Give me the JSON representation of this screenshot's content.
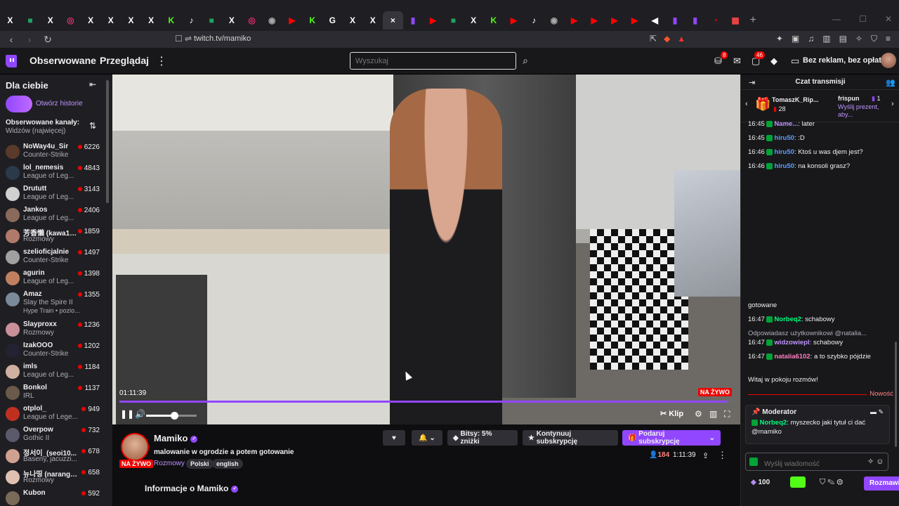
{
  "browser": {
    "tabs": [
      {
        "glyph": "X",
        "color": "#ffffff"
      },
      {
        "glyph": "■",
        "color": "#1fa463"
      },
      {
        "glyph": "X",
        "color": "#ffffff"
      },
      {
        "glyph": "◎",
        "color": "#e1306c"
      },
      {
        "glyph": "X",
        "color": "#ffffff"
      },
      {
        "glyph": "X",
        "color": "#ffffff"
      },
      {
        "glyph": "X",
        "color": "#ffffff"
      },
      {
        "glyph": "X",
        "color": "#ffffff"
      },
      {
        "glyph": "K",
        "color": "#53fc18"
      },
      {
        "glyph": "♪",
        "color": "#ffffff"
      },
      {
        "glyph": "■",
        "color": "#1fa463"
      },
      {
        "glyph": "X",
        "color": "#ffffff"
      },
      {
        "glyph": "◎",
        "color": "#e1306c"
      },
      {
        "glyph": "◉",
        "color": "#aaaaaa"
      },
      {
        "glyph": "▶",
        "color": "#ff0000"
      },
      {
        "glyph": "K",
        "color": "#53fc18"
      },
      {
        "glyph": "G",
        "color": "#ffffff"
      },
      {
        "glyph": "X",
        "color": "#ffffff"
      },
      {
        "glyph": "X",
        "color": "#ffffff"
      },
      {
        "glyph": "×",
        "color": "#ffffff"
      },
      {
        "glyph": "▮",
        "color": "#9147ff"
      },
      {
        "glyph": "▶",
        "color": "#ff0000"
      },
      {
        "glyph": "■",
        "color": "#1fa463"
      },
      {
        "glyph": "X",
        "color": "#ffffff"
      },
      {
        "glyph": "K",
        "color": "#53fc18"
      },
      {
        "glyph": "▶",
        "color": "#ff0000"
      },
      {
        "glyph": "♪",
        "color": "#ffffff"
      },
      {
        "glyph": "◉",
        "color": "#aaaaaa"
      },
      {
        "glyph": "▶",
        "color": "#ff0000"
      },
      {
        "glyph": "▶",
        "color": "#ff0000"
      },
      {
        "glyph": "▶",
        "color": "#ff0000"
      },
      {
        "glyph": "▶",
        "color": "#ff0000"
      },
      {
        "glyph": "◀",
        "color": "#ffffff"
      },
      {
        "glyph": "▮",
        "color": "#9147ff"
      },
      {
        "glyph": "▮",
        "color": "#9147ff"
      },
      {
        "glyph": "◔",
        "color": "#ff0000"
      },
      {
        "glyph": "▦",
        "color": "#ff4444"
      }
    ],
    "active_tab_index": 19,
    "url": "twitch.tv/mamiko"
  },
  "topnav": {
    "following": "Obserwowane",
    "browse": "Przeglądaj",
    "search_placeholder": "Wyszukaj",
    "inbox_badge": "8",
    "notif_badge": "46",
    "ad_free": "Bez reklam, bez opłat",
    "brand_color": "#9147ff"
  },
  "sidebar": {
    "title": "Dla ciebie",
    "stories_link": "Otwórz historie",
    "followed_title": "Obserwowane kanały:",
    "sort": "Widzów (najwięcej)",
    "channels": [
      {
        "name": "NoWay4u_Sir",
        "game": "Counter-Strike",
        "viewers": "6226",
        "avatar": "#5a3a2a"
      },
      {
        "name": "lol_nemesis",
        "game": "League of Leg...",
        "viewers": "4843",
        "avatar": "#2a3a4a"
      },
      {
        "name": "Drututt",
        "game": "League of Leg...",
        "viewers": "3143",
        "avatar": "#d0d0d0"
      },
      {
        "name": "Jankos",
        "game": "League of Leg...",
        "viewers": "2406",
        "avatar": "#8a6a5a"
      },
      {
        "name": "芳香懶 (kawa1s...",
        "game": "Rozmowy",
        "viewers": "1859",
        "avatar": "#b07a6a"
      },
      {
        "name": "szelioficjalnie",
        "game": "Counter-Strike",
        "viewers": "1497",
        "avatar": "#a0a0a0"
      },
      {
        "name": "agurin",
        "game": "League of Leg...",
        "viewers": "1398",
        "avatar": "#c08060"
      },
      {
        "name": "Amaz",
        "game": "Slay the Spire II",
        "viewers": "1355",
        "avatar": "#7a8a9a",
        "extra": "Hype Train • pozio..."
      },
      {
        "name": "Slayproxx",
        "game": "Rozmowy",
        "viewers": "1236",
        "avatar": "#c9909a"
      },
      {
        "name": "IzakOOO",
        "game": "Counter-Strike",
        "viewers": "1202",
        "avatar": "#222233"
      },
      {
        "name": "imls",
        "game": "League of Leg...",
        "viewers": "1184",
        "avatar": "#d0b0a0"
      },
      {
        "name": "Bonkol",
        "game": "IRL",
        "viewers": "1137",
        "avatar": "#6a5a4a"
      },
      {
        "name": "otplol_",
        "game": "League of Lege...",
        "viewers": "949",
        "avatar": "#c03020"
      },
      {
        "name": "Overpow",
        "game": "Gothic II",
        "viewers": "732",
        "avatar": "#5a5a6a"
      },
      {
        "name": "정서이_(seoi10...",
        "game": "Baseny, jacuzzi...",
        "viewers": "678",
        "avatar": "#d0a090"
      },
      {
        "name": "뉴나띵 (narang_...",
        "game": "Rozmowy",
        "viewers": "658",
        "avatar": "#e0c0b0"
      },
      {
        "name": "Kubon",
        "game": "",
        "viewers": "592",
        "avatar": "#7a6a5a"
      }
    ]
  },
  "player": {
    "elapsed": "01:11:39",
    "live": "NA ŻYWO",
    "progress": 0.99,
    "volume": 0.55,
    "clip": "Klip"
  },
  "stream": {
    "name": "Mamiko",
    "title": "malowanie w ogrodzie a potem gotowanie",
    "category": "Rozmowy",
    "tags": [
      "Polski",
      "english"
    ],
    "live": "NA ŻYWO",
    "bits": "Bitsy: 5% zniżki",
    "continue_sub": "Kontynuuj subskrypcję",
    "gift_sub": "Podaruj subskrypcję",
    "viewers": "184",
    "uptime": "1:11:39",
    "about": "Informacje o Mamiko"
  },
  "chat": {
    "title": "Czat transmisji",
    "gifts": [
      {
        "user": "TomaszK_Rip...",
        "count": "28"
      },
      {
        "user": "frispun",
        "count": "1",
        "sub": "Wyślij prezent, aby..."
      }
    ],
    "messages_top": [
      {
        "time": "16:45",
        "user": "Name...",
        "text": "later",
        "color": "#bf94ff"
      },
      {
        "time": "16:45",
        "user": "hiru50",
        "text": ":D",
        "color": "#5c9dff"
      },
      {
        "time": "16:46",
        "user": "hiru50",
        "text": "Ktoś u was djem jest?",
        "color": "#5c9dff"
      },
      {
        "time": "16:46",
        "user": "hiru50",
        "text": "na konsoli grasz?",
        "color": "#5c9dff"
      }
    ],
    "messages_bottom": [
      {
        "time": "",
        "user": "",
        "text": "gotowane",
        "color": "#efeff1"
      },
      {
        "time": "16:47",
        "user": "Norbeq2",
        "text": "schabowy",
        "color": "#00ff7f"
      },
      {
        "time": "16:47",
        "user": "widzowiepl",
        "text": "schabowy",
        "color": "#bf94ff",
        "reply": "Odpowiadasz użytkownikowi @natalia..."
      },
      {
        "time": "16:47",
        "user": "natalia6102",
        "text": "a to szybko pójdzie",
        "color": "#ff7fc0"
      }
    ],
    "welcome": "Witaj w pokoju rozmów!",
    "new_label": "Nowość",
    "moderator_title": "Moderator",
    "moderator_msg_user": "Norbeq2",
    "moderator_msg_text": "myszecko jaki tytuł ci dać @mamiko",
    "input_placeholder": "Wyślij wiadomość",
    "points": "100",
    "send_label": "Rozmawiaj"
  }
}
